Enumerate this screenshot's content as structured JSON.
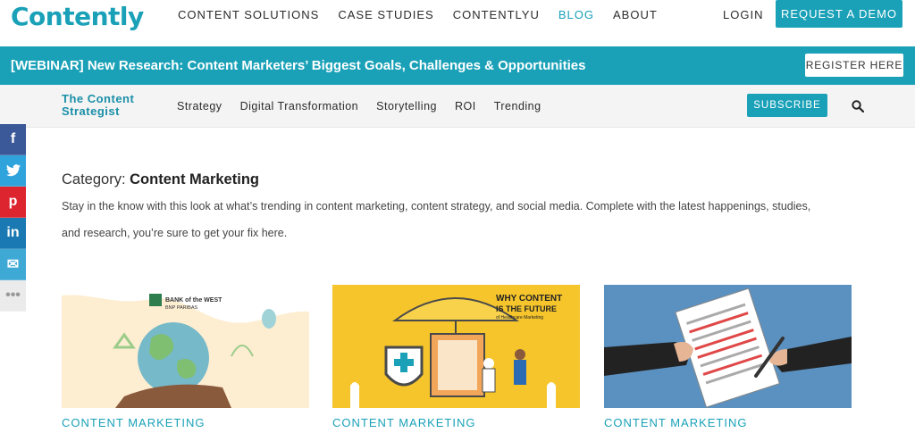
{
  "header": {
    "logo": "Contently",
    "nav": [
      "CONTENT SOLUTIONS",
      "CASE STUDIES",
      "CONTENTLYU",
      "BLOG",
      "ABOUT"
    ],
    "login": "LOGIN",
    "demo_button": "REQUEST A DEMO"
  },
  "banner": {
    "text": "[WEBINAR] New Research: Content Marketers’ Biggest Goals, Challenges & Opportunities",
    "register_button": "REGISTER HERE"
  },
  "subnav": {
    "brand_line1": "The Content",
    "brand_line2": "Strategist",
    "links": [
      "Strategy",
      "Digital Transformation",
      "Storytelling",
      "ROI",
      "Trending"
    ],
    "subscribe_button": "SUBSCRIBE"
  },
  "social": [
    "f",
    "t",
    "p",
    "in",
    "✉",
    "•••"
  ],
  "category": {
    "prefix": "Category:",
    "name": "Content Marketing",
    "description": "Stay in the know with this look at what’s trending in content marketing, content strategy, and social media. Complete with the latest happenings, studies, and research, you’re sure to get your fix here."
  },
  "cards": [
    {
      "label": "CONTENT MARKETING",
      "image_text": "BANK of the WEST BNP PARIBAS"
    },
    {
      "label": "CONTENT MARKETING",
      "image_text": "WHY CONTENT IS THE FUTURE of Healthcare Marketing"
    },
    {
      "label": "CONTENT MARKETING",
      "image_text": ""
    }
  ],
  "colors": {
    "accent": "#1aa1b8",
    "facebook": "#3b5998",
    "twitter": "#2fa3db",
    "pinterest": "#dd2530",
    "linkedin": "#1a78b2"
  }
}
